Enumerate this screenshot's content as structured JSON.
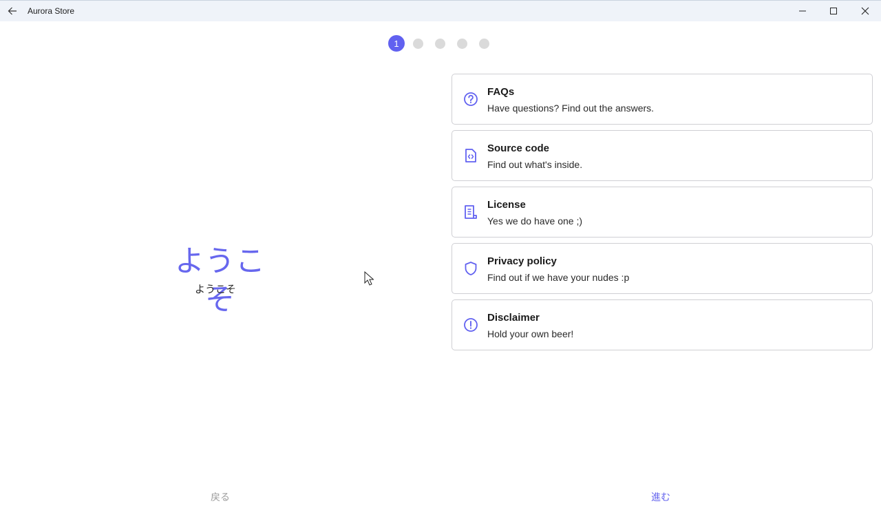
{
  "window": {
    "title": "Aurora Store",
    "back_icon": "arrow-left-icon",
    "controls": [
      "minimize-icon",
      "maximize-icon",
      "close-icon"
    ]
  },
  "stepper": {
    "steps": [
      "1",
      "",
      "",
      "",
      ""
    ],
    "current": 1,
    "active_color": "#6161f0",
    "inactive_color": "#dadada"
  },
  "welcome": {
    "heading": "ようこそ",
    "subheading": "ようこそ",
    "accent_color": "#6767ee"
  },
  "links": [
    {
      "icon": "help-circle-icon",
      "title": "FAQs",
      "subtitle": "Have questions? Find out the answers."
    },
    {
      "icon": "code-file-icon",
      "title": "Source code",
      "subtitle": "Find out what's inside."
    },
    {
      "icon": "license-document-icon",
      "title": "License",
      "subtitle": "Yes we do have one ;)"
    },
    {
      "icon": "shield-icon",
      "title": "Privacy policy",
      "subtitle": "Find out if we have your nudes :p"
    },
    {
      "icon": "alert-circle-icon",
      "title": "Disclaimer",
      "subtitle": "Hold your own beer!"
    }
  ],
  "footer": {
    "back_label": "戻る",
    "next_label": "進む"
  }
}
